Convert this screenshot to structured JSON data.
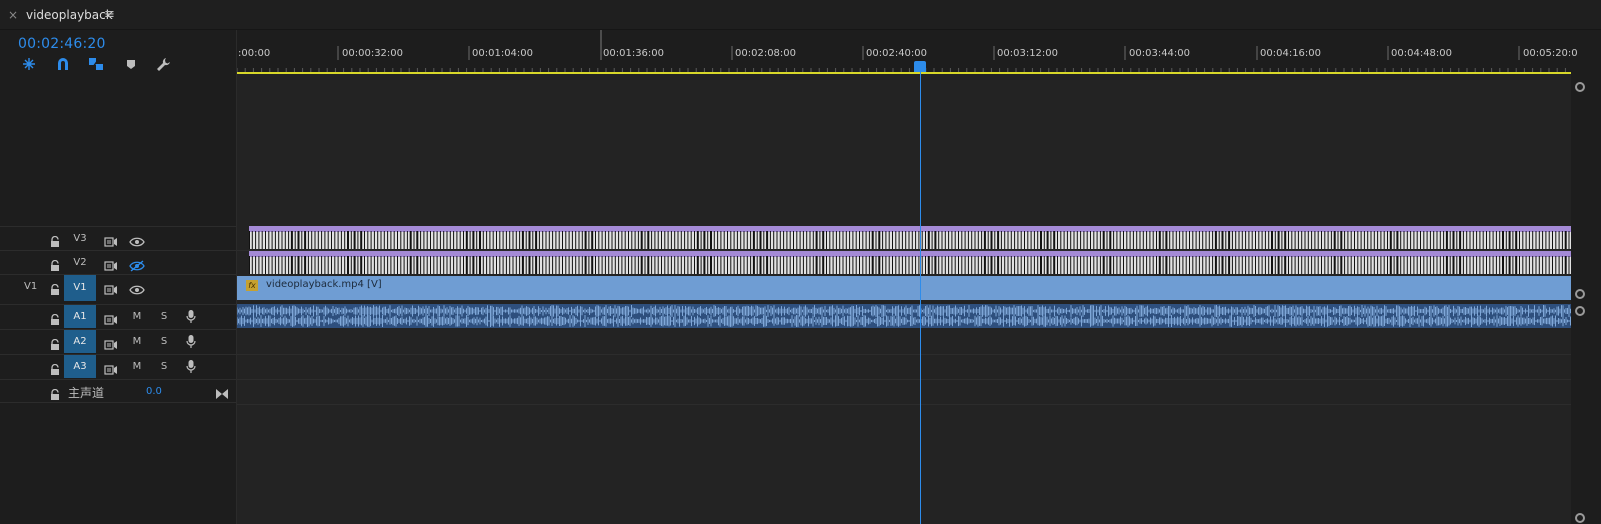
{
  "panel": {
    "tab_title": "videoplayback",
    "close_glyph": "×",
    "menu_glyph": "≡"
  },
  "header": {
    "timecode": "00:02:46:20",
    "tools": [
      "insert-overwrite-sequences-icon",
      "snap-magnet-icon",
      "linked-selection-icon",
      "add-marker-icon",
      "timeline-settings-wrench-icon"
    ]
  },
  "ruler": {
    "labels": [
      ":00:00",
      "00:00:32:00",
      "00:01:04:00",
      "00:01:36:00",
      "00:02:08:00",
      "00:02:40:00",
      "00:03:12:00",
      "00:03:44:00",
      "00:04:16:00",
      "00:04:48:00",
      "00:05:20:0"
    ]
  },
  "tracks": {
    "v3": {
      "name": "V3"
    },
    "v2": {
      "name": "V2"
    },
    "v1": {
      "source": "V1",
      "name": "V1"
    },
    "a1": {
      "name": "A1",
      "mute": "M",
      "solo": "S"
    },
    "a2": {
      "name": "A2",
      "mute": "M",
      "solo": "S"
    },
    "a3": {
      "name": "A3",
      "mute": "M",
      "solo": "S"
    },
    "master": {
      "label": "主声道",
      "value": "0.0"
    }
  },
  "clips": {
    "v1_name": "videoplayback.mp4 [V]",
    "fx_badge": "fx"
  },
  "colors": {
    "accent": "#2d8ceb",
    "video_clip": "#6f9dd3",
    "audio_clip": "#2e4f7d",
    "nested_clip": "#a48ad6",
    "work_area": "#d8d82a"
  }
}
